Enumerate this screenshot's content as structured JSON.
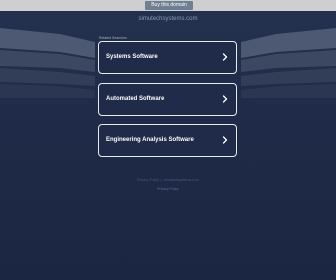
{
  "topbar": {
    "buy_label": "Buy this domain"
  },
  "domain": {
    "name": "simutechsystems.com"
  },
  "related": {
    "label": "Related Searches",
    "items": [
      {
        "label": "Systems Software"
      },
      {
        "label": "Automated Software"
      },
      {
        "label": "Engineering Analysis Software"
      }
    ]
  },
  "footer": {
    "privacy_text": "Privacy Policy — simutechsystems.com",
    "privacy_link": "Privacy Policy"
  },
  "colors": {
    "background": "#1e2a46",
    "card_border": "#e7ebf2",
    "topbar": "#cfcfd1",
    "buy_button": "#6f7f92"
  },
  "icons": {
    "chevron": "chevron-right-icon"
  }
}
